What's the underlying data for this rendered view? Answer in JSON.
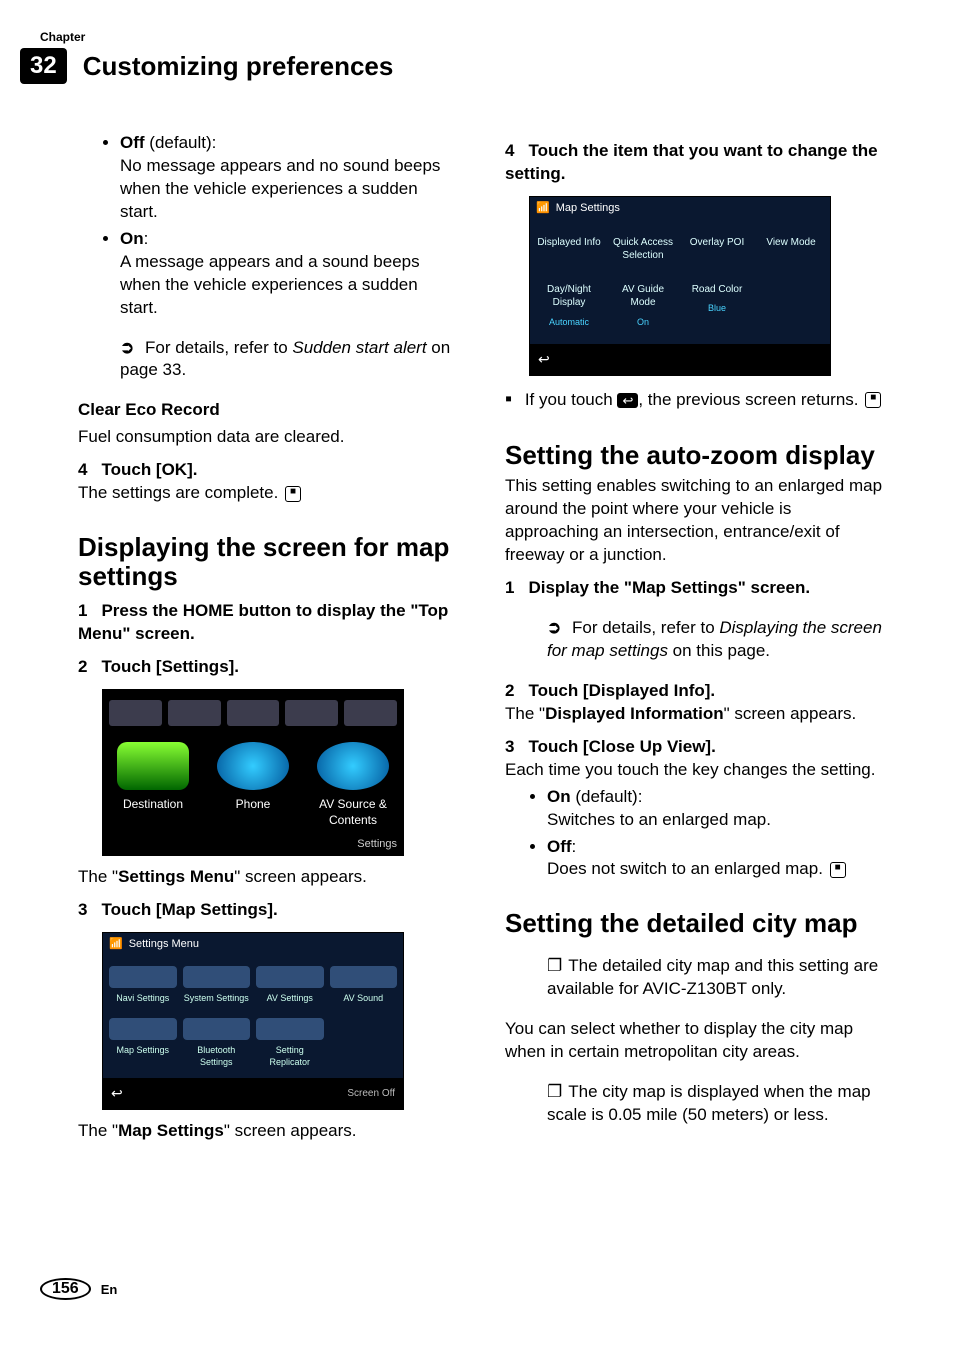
{
  "header": {
    "chapter_label": "Chapter",
    "chapter_number": "32",
    "chapter_title": "Customizing preferences"
  },
  "col1": {
    "off_label": "Off",
    "off_default": "(default):",
    "off_desc": "No message appears and no sound beeps when the vehicle experiences a sudden start.",
    "on_label": "On",
    "on_colon": ":",
    "on_desc": "A message appears and a sound beeps when the vehicle experiences a sudden start.",
    "ref_prefix": "For details, refer to ",
    "ref_ital": "Sudden start alert",
    "ref_suffix": " on page 33.",
    "clear_eco_title": "Clear Eco Record",
    "clear_eco_desc": "Fuel consumption data are cleared.",
    "step4_num": "4",
    "step4_text": "Touch [OK].",
    "step4_desc": "The settings are complete.",
    "h2_display": "Displaying the screen for map settings",
    "step1_num": "1",
    "step1_text": "Press the HOME button to display the \"Top Menu\" screen.",
    "step2_num": "2",
    "step2_text": "Touch [Settings].",
    "after_shot1_pre": "The \"",
    "after_shot1_bold": "Settings Menu",
    "after_shot1_post": "\" screen appears.",
    "step3_num": "3",
    "step3_text": "Touch [Map Settings].",
    "after_shot2_pre": "The \"",
    "after_shot2_bold": "Map Settings",
    "after_shot2_post": "\" screen appears."
  },
  "shot_topmenu": {
    "destination": "Destination",
    "phone": "Phone",
    "av_line1": "AV Source &",
    "av_line2": "Contents",
    "settings": "Settings"
  },
  "shot_settings": {
    "title": "Settings Menu",
    "navi": "Navi Settings",
    "system": "System Settings",
    "av_settings": "AV Settings",
    "av_sound": "AV Sound",
    "map": "Map Settings",
    "bt": "Bluetooth Settings",
    "replicator": "Setting Replicator",
    "screen_off": "Screen Off"
  },
  "col2": {
    "step4_num": "4",
    "step4_text": "Touch the item that you want to change the setting.",
    "back_note_pre": "If you touch ",
    "back_note_post": ", the previous screen returns.",
    "h2_autozoom": "Setting the auto-zoom display",
    "autozoom_desc": "This setting enables switching to an enlarged map around the point where your vehicle is approaching an intersection, entrance/exit of freeway or a junction.",
    "az_step1_num": "1",
    "az_step1_text": "Display the \"Map Settings\" screen.",
    "az_ref_prefix": "For details, refer to ",
    "az_ref_ital": "Displaying the screen for map settings",
    "az_ref_suffix": " on this page.",
    "az_step2_num": "2",
    "az_step2_text": "Touch [Displayed Info].",
    "az_step2_desc_pre": "The \"",
    "az_step2_desc_bold": "Displayed Information",
    "az_step2_desc_post": "\" screen appears.",
    "az_step3_num": "3",
    "az_step3_text": "Touch [Close Up View].",
    "az_step3_desc": "Each time you touch the key changes the setting.",
    "az_on_label": "On",
    "az_on_default": "(default):",
    "az_on_desc": "Switches to an enlarged map.",
    "az_off_label": "Off",
    "az_off_colon": ":",
    "az_off_desc": "Does not switch to an enlarged map.",
    "h2_citymap": "Setting the detailed city map",
    "city_note1": "The detailed city map and this setting are available for AVIC-Z130BT only.",
    "city_desc": "You can select whether to display the city map when in certain metropolitan city areas.",
    "city_note2": "The city map is displayed when the map scale is 0.05 mile (50 meters) or less."
  },
  "shot_map": {
    "title": "Map Settings",
    "cells": {
      "displayed_info": "Displayed Info",
      "quick_access": "Quick Access Selection",
      "overlay_poi": "Overlay POI",
      "view_mode": "View Mode",
      "day_night": "Day/Night Display",
      "day_night_val": "Automatic",
      "av_guide": "AV Guide Mode",
      "av_guide_val": "On",
      "road_color": "Road Color",
      "road_color_val": "Blue"
    }
  },
  "footer": {
    "page_number": "156",
    "lang": "En"
  }
}
